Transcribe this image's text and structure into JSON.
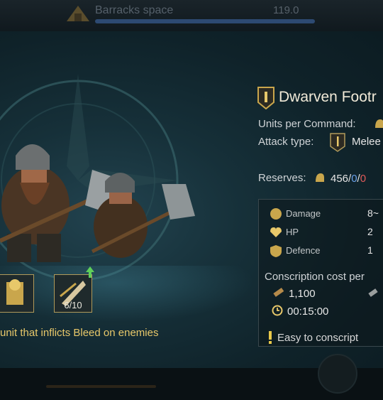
{
  "topbar": {
    "title": "Barracks space",
    "value": "119.0",
    "capacity_fraction": 1.0,
    "barracks_icon": "barracks-tent-icon"
  },
  "unit": {
    "name": "Dwarven Footr",
    "units_per_command_label": "Units per Command:",
    "attack_type_label": "Attack type:",
    "attack_type_value": "Melee",
    "reserves_label": "Reserves:",
    "reserves_total": "456",
    "reserves_a": "0",
    "reserves_b": "0",
    "reserves_sep": "/"
  },
  "stats": [
    {
      "label": "Damage",
      "value": "8~",
      "icon": "damage-fist-icon"
    },
    {
      "label": "HP",
      "value": "2",
      "icon": "hp-heart-icon"
    },
    {
      "label": "Defence",
      "value": "1",
      "icon": "defence-shield-icon"
    }
  ],
  "conscription": {
    "label": "Conscription cost per",
    "resource_cost": "1,100",
    "time": "00:15:00",
    "easy_text": "Easy to conscript"
  },
  "skills": {
    "level": "6/10",
    "description": "unit that inflicts Bleed on enemies"
  },
  "colors": {
    "accent_gold": "#e8c86a",
    "reserves_blue": "#6aa0e8",
    "reserves_red": "#e05a5a"
  }
}
